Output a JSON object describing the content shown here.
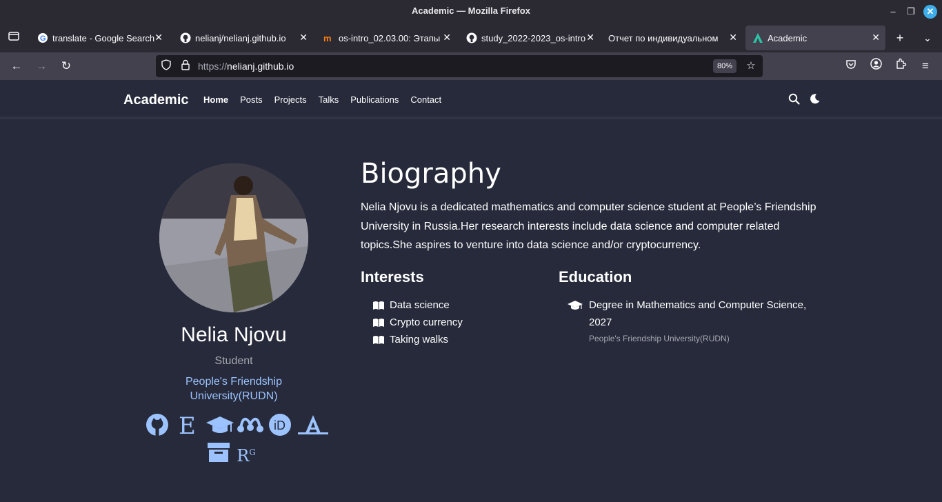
{
  "window": {
    "title": "Academic — Mozilla Firefox"
  },
  "tabs": [
    {
      "label": "translate - Google Search",
      "icon": "google-icon"
    },
    {
      "label": "nelianj/nelianj.github.io",
      "icon": "github-icon"
    },
    {
      "label": "os-intro_02.03.00: Этапы",
      "icon": "moodle-icon"
    },
    {
      "label": "study_2022-2023_os-intro",
      "icon": "github-icon"
    },
    {
      "label": "Отчет по индивидуальном",
      "icon": "none"
    },
    {
      "label": "Academic",
      "icon": "academic-icon",
      "active": true
    }
  ],
  "navbar": {
    "url_proto": "https://",
    "url_host": "nelianj.github.io",
    "zoom": "80%"
  },
  "site": {
    "brand": "Academic",
    "menu": [
      "Home",
      "Posts",
      "Projects",
      "Talks",
      "Publications",
      "Contact"
    ],
    "active_menu": "Home"
  },
  "profile": {
    "name": "Nelia Njovu",
    "role": "Student",
    "organization": "People's Friendship University(RUDN)",
    "socials": [
      "github-icon",
      "e-icon",
      "graduation-cap-icon",
      "mendeley-icon",
      "orcid-icon",
      "academia-icon",
      "archive-icon",
      "researchgate-icon"
    ],
    "researchgate_label": "R",
    "researchgate_sup": "G"
  },
  "biography": {
    "title": "Biography",
    "text": "Nelia Njovu is a dedicated mathematics and computer science student at People’s Friendship University in Russia.Her research interests include data science and computer related topics.She aspires to venture into data science and/or cryptocurrency.",
    "interests_title": "Interests",
    "interests": [
      "Data science",
      "Crypto currency",
      "Taking walks"
    ],
    "education_title": "Education",
    "education": [
      {
        "degree": "Degree in Mathematics and Computer Science, 2027",
        "institution": "People's Friendship University(RUDN)"
      }
    ]
  }
}
